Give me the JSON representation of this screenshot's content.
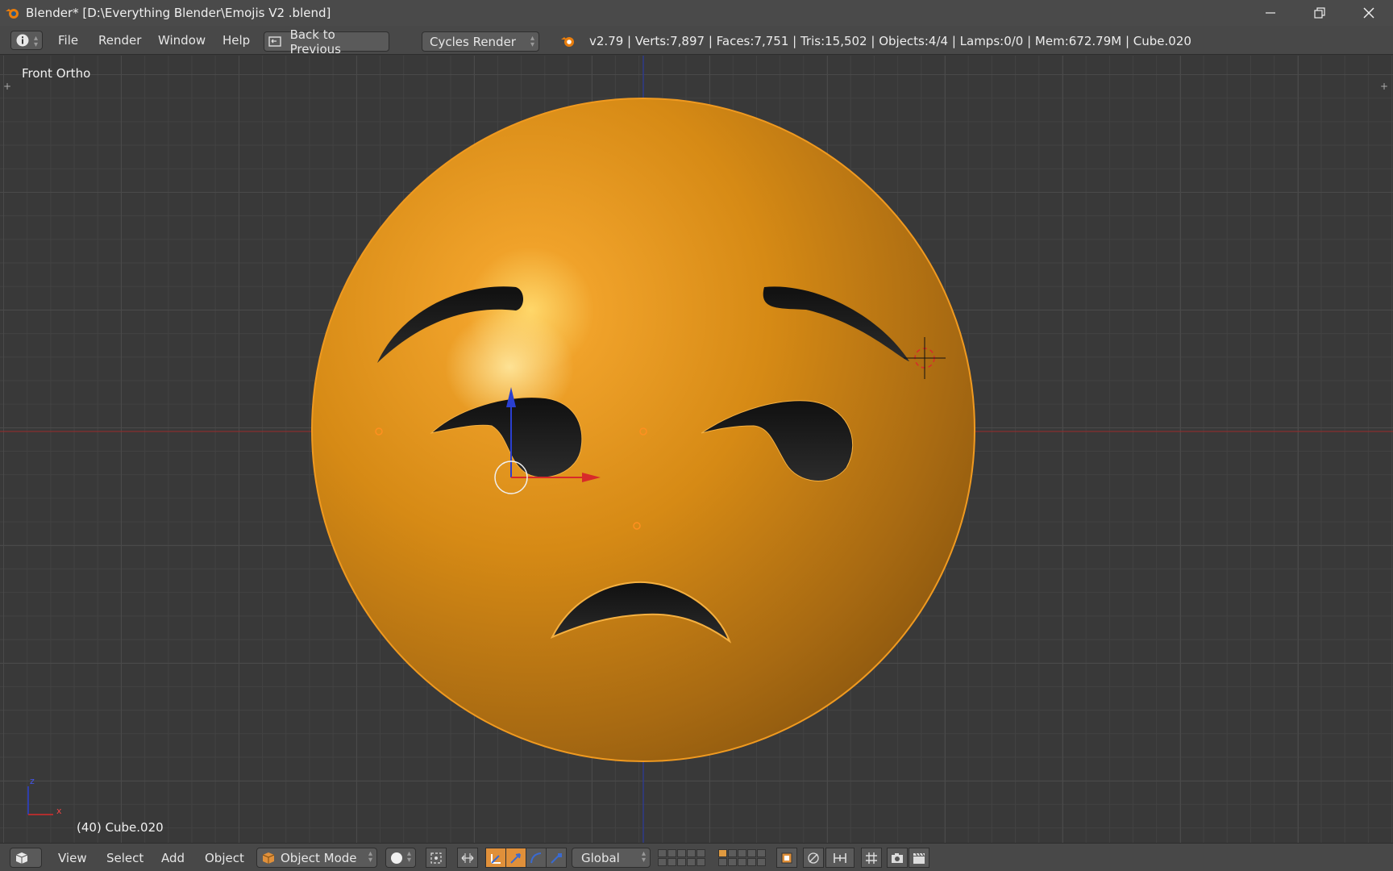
{
  "window": {
    "title": "Blender* [D:\\Everything Blender\\Emojis V2 .blend]",
    "controls": [
      "minimize",
      "restore",
      "close"
    ]
  },
  "info_header": {
    "menus": [
      "File",
      "Render",
      "Window",
      "Help"
    ],
    "back_button": "Back to Previous",
    "render_engine": "Cycles Render",
    "stats": "v2.79 | Verts:7,897 | Faces:7,751 | Tris:15,502 | Objects:4/4 | Lamps:0/0 | Mem:672.79M | Cube.020"
  },
  "viewport": {
    "view_name": "Front Ortho",
    "active_object": "(40) Cube.020",
    "axis_labels": {
      "z": "z",
      "x": "x"
    },
    "emoji_color": "#e08a18"
  },
  "bottom_header": {
    "menus": [
      "View",
      "Select",
      "Add",
      "Object"
    ],
    "mode": "Object Mode",
    "orientation": "Global"
  },
  "colors": {
    "accent": "#e0903a",
    "x_axis": "#d82a2a",
    "z_axis": "#2a3fd0",
    "header": "#484848",
    "viewport_bg": "#393939"
  }
}
